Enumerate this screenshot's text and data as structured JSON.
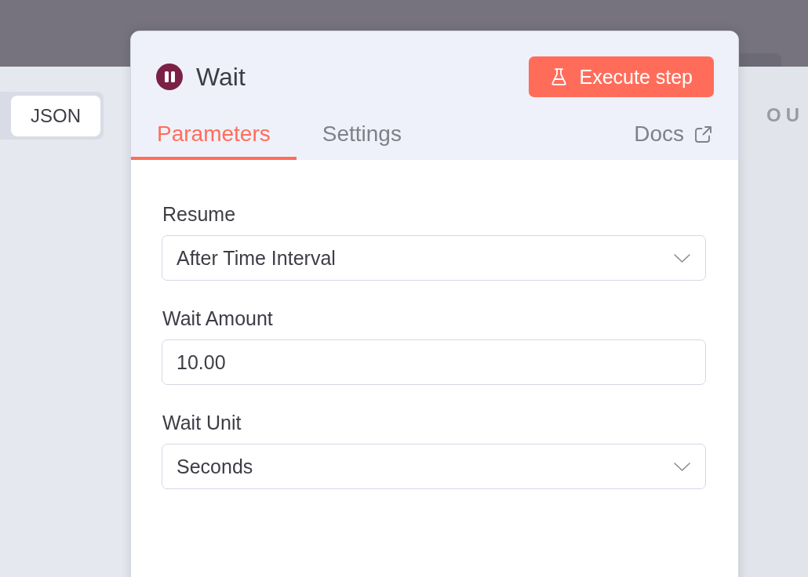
{
  "input_panel": {
    "display_toggle": {
      "label": "JSON",
      "selected": true
    }
  },
  "node_panel": {
    "title": "Wait",
    "execute_button": {
      "label": "Execute step"
    },
    "tabs": [
      {
        "label": "Parameters",
        "selected": true
      },
      {
        "label": "Settings",
        "selected": false
      }
    ],
    "docs_link": {
      "label": "Docs"
    },
    "fields": [
      {
        "kind": "select",
        "label": "Resume",
        "value": "After Time Interval"
      },
      {
        "kind": "number",
        "label": "Wait Amount",
        "value": "10.00"
      },
      {
        "kind": "select",
        "label": "Wait Unit",
        "value": "Seconds"
      }
    ]
  },
  "output_panel": {
    "heading": "OU"
  }
}
